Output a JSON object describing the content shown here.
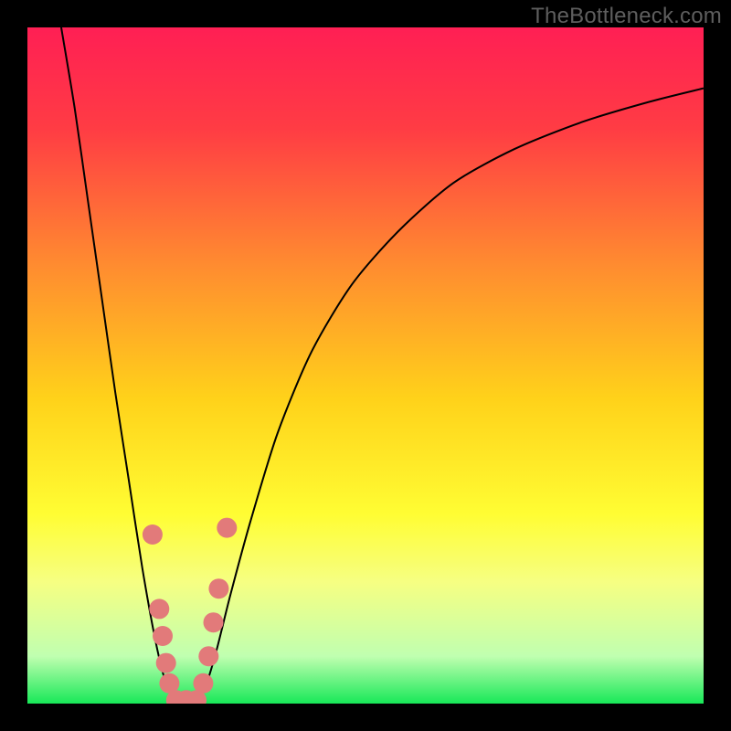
{
  "watermark": "TheBottleneck.com",
  "chart_data": {
    "type": "line",
    "title": "",
    "xlabel": "",
    "ylabel": "",
    "xlim": [
      0,
      100
    ],
    "ylim": [
      0,
      100
    ],
    "gradient_stops": [
      {
        "pos": 0.0,
        "color": "#ff1f54"
      },
      {
        "pos": 0.15,
        "color": "#ff3c44"
      },
      {
        "pos": 0.35,
        "color": "#ff8b30"
      },
      {
        "pos": 0.55,
        "color": "#ffd21a"
      },
      {
        "pos": 0.72,
        "color": "#fffd33"
      },
      {
        "pos": 0.82,
        "color": "#f6ff82"
      },
      {
        "pos": 0.93,
        "color": "#c0ffb0"
      },
      {
        "pos": 1.0,
        "color": "#18e858"
      }
    ],
    "series": [
      {
        "name": "left-curve",
        "x": [
          5,
          7,
          9,
          11,
          13,
          15,
          17,
          19,
          20.5,
          22
        ],
        "y": [
          100,
          88,
          74,
          60,
          46,
          33,
          20,
          9,
          3,
          0
        ]
      },
      {
        "name": "right-curve",
        "x": [
          25,
          26.5,
          28,
          30,
          33,
          37,
          42,
          48,
          55,
          63,
          72,
          82,
          92,
          100
        ],
        "y": [
          0,
          3,
          8,
          16,
          27,
          40,
          52,
          62,
          70,
          77,
          82,
          86,
          89,
          91
        ]
      }
    ],
    "markers": {
      "name": "dip-markers",
      "color": "#e27a7a",
      "radius_px": 11,
      "points": [
        {
          "x": 18.5,
          "y": 25
        },
        {
          "x": 19.5,
          "y": 14
        },
        {
          "x": 20.0,
          "y": 10
        },
        {
          "x": 20.5,
          "y": 6
        },
        {
          "x": 21.0,
          "y": 3
        },
        {
          "x": 22.0,
          "y": 0.5
        },
        {
          "x": 23.5,
          "y": 0.5
        },
        {
          "x": 25.0,
          "y": 0.5
        },
        {
          "x": 26.0,
          "y": 3
        },
        {
          "x": 26.8,
          "y": 7
        },
        {
          "x": 27.5,
          "y": 12
        },
        {
          "x": 28.3,
          "y": 17
        },
        {
          "x": 29.5,
          "y": 26
        }
      ]
    }
  }
}
